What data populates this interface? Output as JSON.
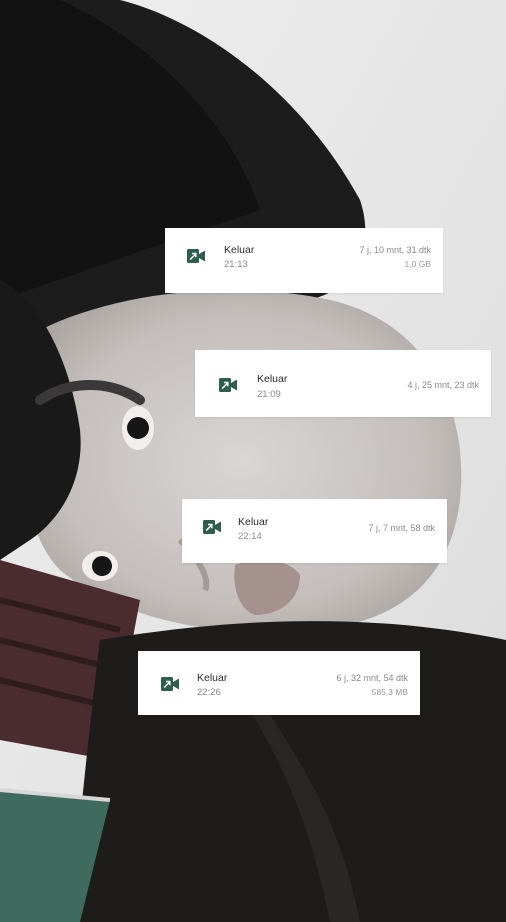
{
  "colors": {
    "icon_green": "#2f5d4e",
    "card_background": "#ffffff",
    "title_text": "#2b2b2b",
    "secondary_text": "#8a8a8a"
  },
  "call_log": [
    {
      "status": "Keluar",
      "time": "21:13",
      "duration": "7 j, 10 mnt, 31 dtk",
      "size": "1,0 GB",
      "icon": "outgoing-video-call-icon"
    },
    {
      "status": "Keluar",
      "time": "21:09",
      "duration": "4 j, 25 mnt, 23 dtk",
      "size": "",
      "icon": "outgoing-video-call-icon"
    },
    {
      "status": "Keluar",
      "time": "22:14",
      "duration": "7 j, 7 mnt, 58 dtk",
      "size": "",
      "icon": "outgoing-video-call-icon"
    },
    {
      "status": "Keluar",
      "time": "22:26",
      "duration": "6 j, 32 mnt, 54 dtk",
      "size": "585,3 MB",
      "icon": "outgoing-video-call-icon"
    }
  ]
}
